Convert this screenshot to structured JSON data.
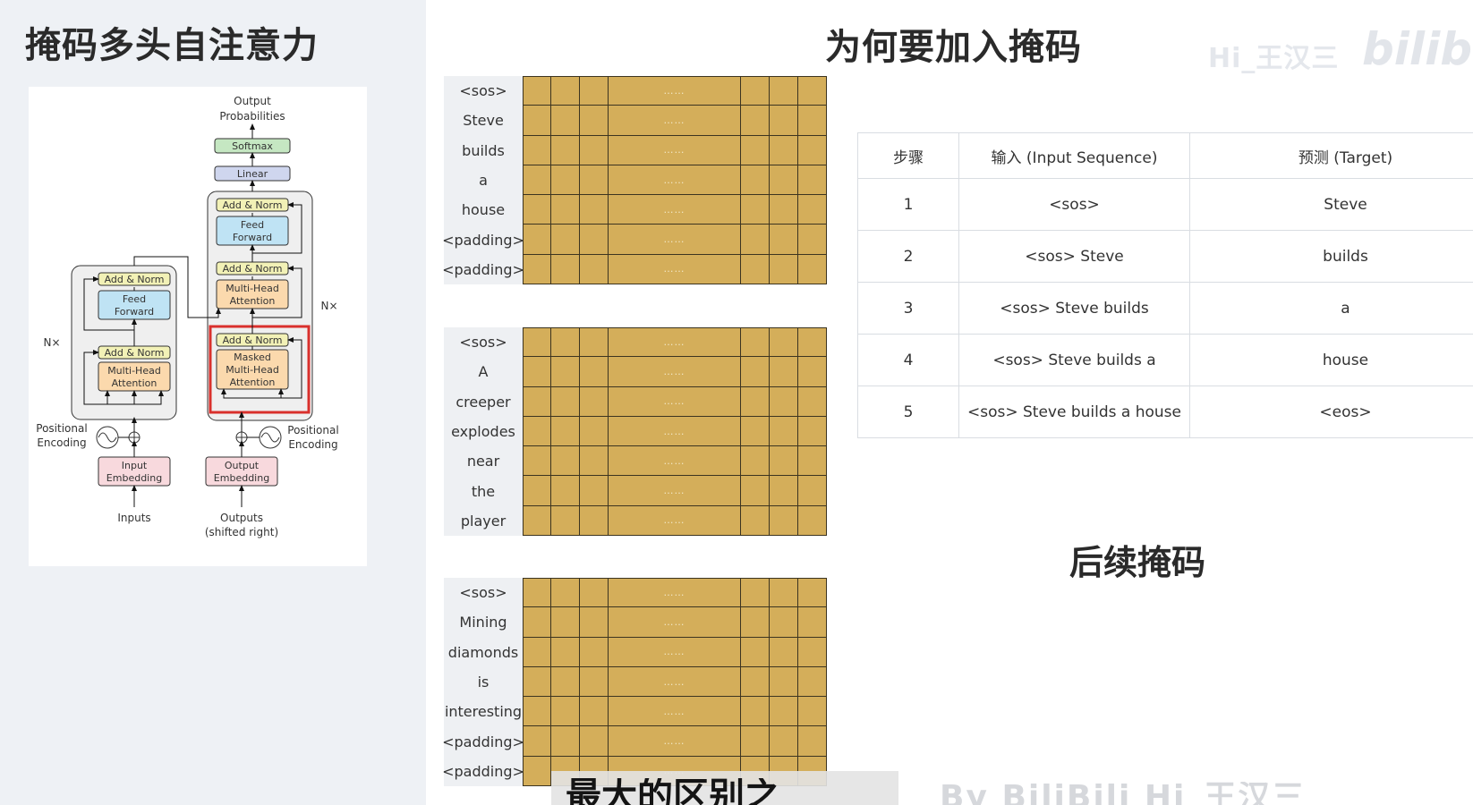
{
  "left": {
    "title": "掩码多头自注意力",
    "diagram": {
      "output_probabilities": "Output\nProbabilities",
      "softmax": "Softmax",
      "linear": "Linear",
      "add_norm": "Add & Norm",
      "feed_forward": "Feed\nForward",
      "multi_head_attention": "Multi-Head\nAttention",
      "masked_multi_head_attention": "Masked\nMulti-Head\nAttention",
      "nx": "N×",
      "positional_encoding": "Positional\nEncoding",
      "input_embedding": "Input\nEmbedding",
      "output_embedding": "Output\nEmbedding",
      "inputs": "Inputs",
      "outputs": "Outputs\n(shifted right)"
    }
  },
  "main": {
    "title": "为何要加入掩码",
    "watermark": "Hi_王汉三",
    "watermark_logo": "bilibili",
    "ellipsis": "……",
    "sequences": [
      {
        "tokens": [
          "<sos>",
          "Steve",
          "builds",
          "a",
          "house",
          "<padding>",
          "<padding>"
        ]
      },
      {
        "tokens": [
          "<sos>",
          "A",
          "creeper",
          "explodes",
          "near",
          "the",
          "player"
        ]
      },
      {
        "tokens": [
          "<sos>",
          "Mining",
          "diamonds",
          "is",
          "interesting",
          "<padding>",
          "<padding>"
        ]
      }
    ],
    "table": {
      "headers": [
        "步骤",
        "输入 (Input Sequence)",
        "预测 (Target)"
      ],
      "rows": [
        [
          "1",
          "<sos>",
          "Steve"
        ],
        [
          "2",
          "<sos> Steve",
          "builds"
        ],
        [
          "3",
          "<sos> Steve builds",
          "a"
        ],
        [
          "4",
          "<sos> Steve builds a",
          "house"
        ],
        [
          "5",
          "<sos> Steve builds a house",
          "<eos>"
        ]
      ]
    },
    "subsequent_title": "后续掩码",
    "caption": "最大的区别之",
    "byline": "By BiliBili   Hi_王汉三"
  },
  "colors": {
    "mask_cell": "#d4ae5a",
    "highlight_red": "#d9302c",
    "left_bg": "#eef1f5"
  }
}
